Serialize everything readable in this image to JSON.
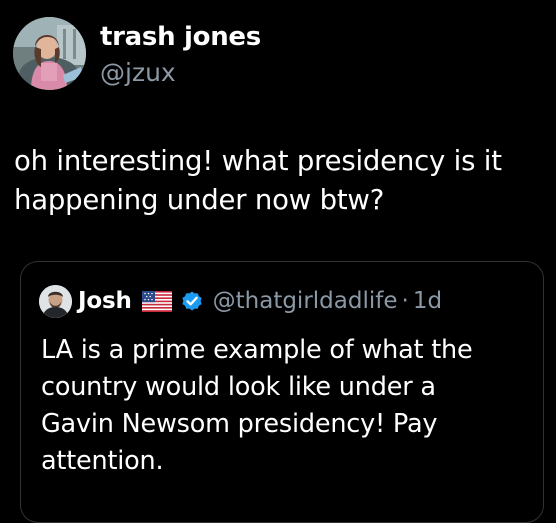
{
  "author": {
    "name": "trash jones",
    "handle": "@jzux"
  },
  "tweet": {
    "text": "oh interesting! what presidency is it happening under now btw?"
  },
  "quoted_tweet": {
    "name": "Josh",
    "flag_icon": "us-flag-icon",
    "verified": true,
    "handle": "@thatgirldadlife",
    "separator": "·",
    "time": "1d",
    "text": "LA is a prime example of what the country would look like under a Gavin Newsom presidency!  Pay attention."
  },
  "colors": {
    "background": "#000000",
    "text_primary": "#ffffff",
    "text_secondary": "#8b98a5",
    "border": "#2f3336",
    "verified_blue": "#1d9bf0"
  }
}
